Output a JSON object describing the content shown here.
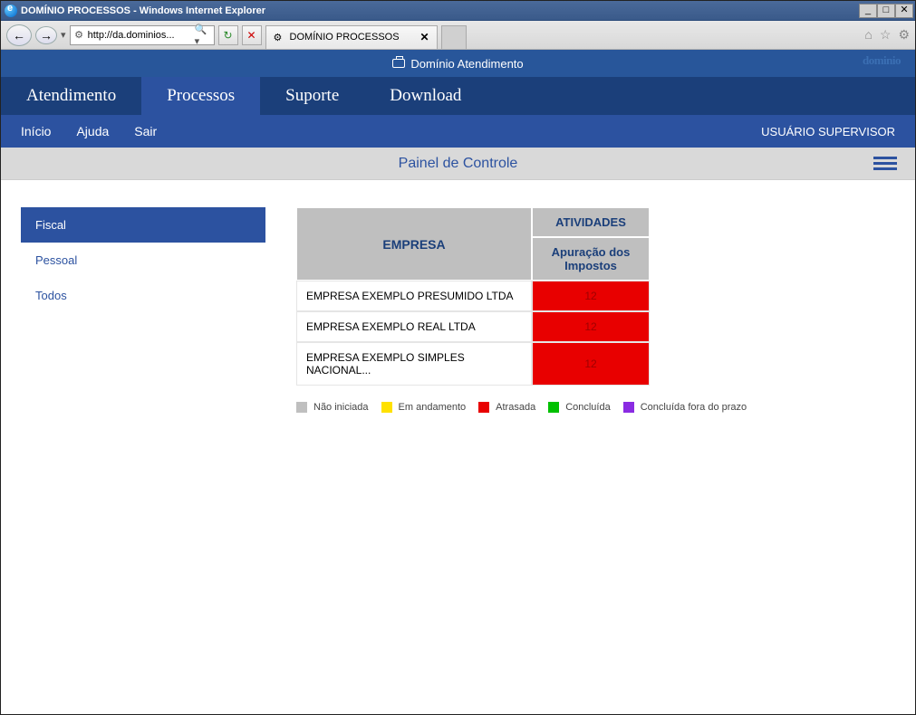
{
  "window": {
    "title": "DOMÍNIO PROCESSOS - Windows Internet Explorer",
    "address": "http://da.dominios...",
    "tab_title": "DOMÍNIO PROCESSOS"
  },
  "banner": {
    "title": "Domínio Atendimento",
    "logo": "dominio"
  },
  "mainnav": {
    "items": [
      "Atendimento",
      "Processos",
      "Suporte",
      "Download"
    ],
    "active_index": 1
  },
  "subnav": {
    "items": [
      "Início",
      "Ajuda",
      "Sair"
    ],
    "user": "USUÁRIO SUPERVISOR"
  },
  "pagebar": {
    "title": "Painel de Controle"
  },
  "sidepanel": {
    "items": [
      "Fiscal",
      "Pessoal",
      "Todos"
    ],
    "active_index": 0
  },
  "table": {
    "header_company": "EMPRESA",
    "header_group": "ATIVIDADES",
    "header_sub": "Apuração dos Impostos",
    "rows": [
      {
        "company": "EMPRESA EXEMPLO PRESUMIDO LTDA",
        "value": "12"
      },
      {
        "company": "EMPRESA EXEMPLO REAL LTDA",
        "value": "12"
      },
      {
        "company": "EMPRESA EXEMPLO SIMPLES NACIONAL...",
        "value": "12"
      }
    ]
  },
  "legend": {
    "items": [
      {
        "label": "Não iniciada",
        "color": "#bfbfbf"
      },
      {
        "label": "Em andamento",
        "color": "#ffe100"
      },
      {
        "label": "Atrasada",
        "color": "#e80000"
      },
      {
        "label": "Concluída",
        "color": "#00c000"
      },
      {
        "label": "Concluída fora do prazo",
        "color": "#8a2be2"
      }
    ]
  }
}
